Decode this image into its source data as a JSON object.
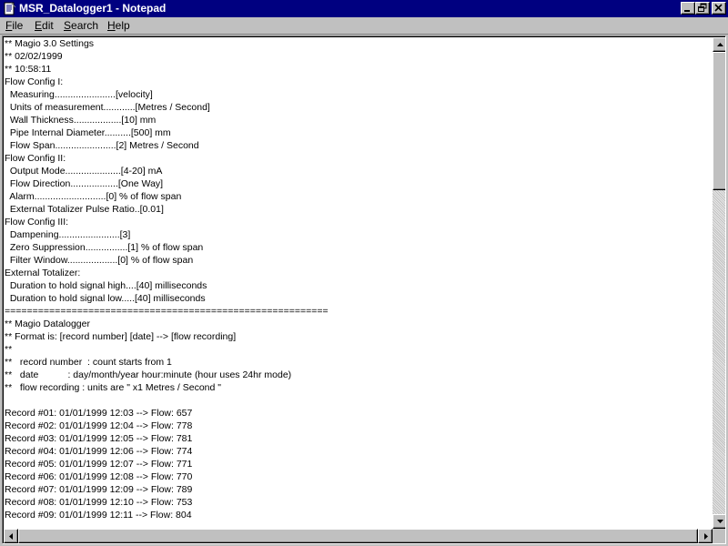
{
  "window": {
    "title": "MSR_Datalogger1 - Notepad"
  },
  "menu": {
    "file": {
      "key": "F",
      "rest": "ile"
    },
    "edit": {
      "key": "E",
      "rest": "dit"
    },
    "search": {
      "key": "S",
      "rest": "earch"
    },
    "help": {
      "key": "H",
      "rest": "elp"
    }
  },
  "document": {
    "lines": [
      "** Magio 3.0 Settings",
      "** 02/02/1999",
      "** 10:58:11",
      "Flow Config I:",
      "  Measuring.......................[velocity]",
      "  Units of measurement............[Metres / Second]",
      "  Wall Thickness..................[10] mm",
      "  Pipe Internal Diameter..........[500] mm",
      "  Flow Span.......................[2] Metres / Second",
      "Flow Config II:",
      "  Output Mode.....................[4-20] mA",
      "  Flow Direction..................[One Way]",
      "  Alarm...........................[0] % of flow span",
      "  External Totalizer Pulse Ratio..[0.01]",
      "Flow Config III:",
      "  Dampening.......................[3]",
      "  Zero Suppression................[1] % of flow span",
      "  Filter Window...................[0] % of flow span",
      "External Totalizer:",
      "  Duration to hold signal high....[40] milliseconds",
      "  Duration to hold signal low.....[40] milliseconds",
      "==========================================================",
      "** Magio Datalogger",
      "** Format is: [record number] [date] --> [flow recording]",
      "**",
      "**   record number  : count starts from 1",
      "**   date           : day/month/year hour:minute (hour uses 24hr mode)",
      "**   flow recording : units are \" x1 Metres / Second \"",
      "",
      "Record #01: 01/01/1999 12:03 --> Flow: 657",
      "Record #02: 01/01/1999 12:04 --> Flow: 778",
      "Record #03: 01/01/1999 12:05 --> Flow: 781",
      "Record #04: 01/01/1999 12:06 --> Flow: 774",
      "Record #05: 01/01/1999 12:07 --> Flow: 771",
      "Record #06: 01/01/1999 12:08 --> Flow: 770",
      "Record #07: 01/01/1999 12:09 --> Flow: 789",
      "Record #08: 01/01/1999 12:10 --> Flow: 753",
      "Record #09: 01/01/1999 12:11 --> Flow: 804"
    ]
  },
  "icons": {
    "app": "notepad-icon",
    "minimize": "minimize-icon",
    "maximize": "restore-icon",
    "close": "close-icon",
    "scroll_up": "arrow-up-icon",
    "scroll_down": "arrow-down-icon",
    "scroll_left": "arrow-left-icon",
    "scroll_right": "arrow-right-icon"
  },
  "colors": {
    "titlebar": "#000080",
    "face": "#c0c0c0",
    "text_bg": "#ffffff"
  }
}
